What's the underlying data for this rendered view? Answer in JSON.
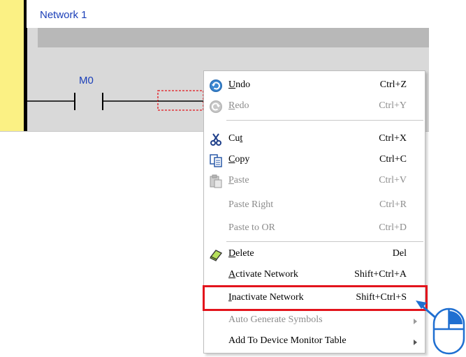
{
  "editor": {
    "network_title": "Network 1",
    "contact_label": "M0"
  },
  "context_menu": {
    "items": [
      {
        "id": "undo",
        "mnemonic": "U",
        "rest": "ndo",
        "label": "Undo",
        "shortcut": "Ctrl+Z",
        "enabled": true,
        "icon": "undo-icon"
      },
      {
        "id": "redo",
        "mnemonic": "R",
        "rest": "edo",
        "label": "Redo",
        "shortcut": "Ctrl+Y",
        "enabled": false,
        "icon": "redo-icon"
      },
      {
        "id": "cut",
        "pre": "Cu",
        "mnemonic": "t",
        "label": "Cut",
        "shortcut": "Ctrl+X",
        "enabled": true,
        "icon": "scissors-icon"
      },
      {
        "id": "copy",
        "mnemonic": "C",
        "rest": "opy",
        "label": "Copy",
        "shortcut": "Ctrl+C",
        "enabled": true,
        "icon": "copy-icon"
      },
      {
        "id": "paste",
        "mnemonic": "P",
        "rest": "aste",
        "label": "Paste",
        "shortcut": "Ctrl+V",
        "enabled": false,
        "icon": "paste-icon"
      },
      {
        "id": "paste_right",
        "label": "Paste Right",
        "shortcut": "Ctrl+R",
        "enabled": false
      },
      {
        "id": "paste_to_or",
        "label": "Paste to OR",
        "shortcut": "Ctrl+D",
        "enabled": false
      },
      {
        "id": "delete",
        "mnemonic": "D",
        "rest": "elete",
        "label": "Delete",
        "shortcut": "Del",
        "enabled": true,
        "icon": "eraser-icon"
      },
      {
        "id": "activate_network",
        "mnemonic": "A",
        "rest": "ctivate Network",
        "label": "Activate Network",
        "shortcut": "Shift+Ctrl+A",
        "enabled": true
      },
      {
        "id": "inactivate_network",
        "mnemonic": "I",
        "rest": "nactivate Network",
        "label": "Inactivate Network",
        "shortcut": "Shift+Ctrl+S",
        "enabled": true
      },
      {
        "id": "auto_generate_symbols",
        "label": "Auto Generate Symbols",
        "shortcut": "",
        "enabled": false,
        "submenu": true
      },
      {
        "id": "add_to_device_monitor_table",
        "label": "Add To Device Monitor Table",
        "shortcut": "",
        "enabled": true,
        "submenu": true
      }
    ],
    "highlighted_item": "inactivate_network"
  },
  "colors": {
    "highlight": "#e3141c",
    "network_text": "#1b3fb8",
    "margin": "#fbf184",
    "pointer": "#1f6fd1"
  },
  "icons": [
    "undo-icon",
    "redo-icon",
    "scissors-icon",
    "copy-icon",
    "paste-icon",
    "eraser-icon",
    "submenu-arrow-icon",
    "mouse-icon",
    "pointer-arrow-icon"
  ]
}
